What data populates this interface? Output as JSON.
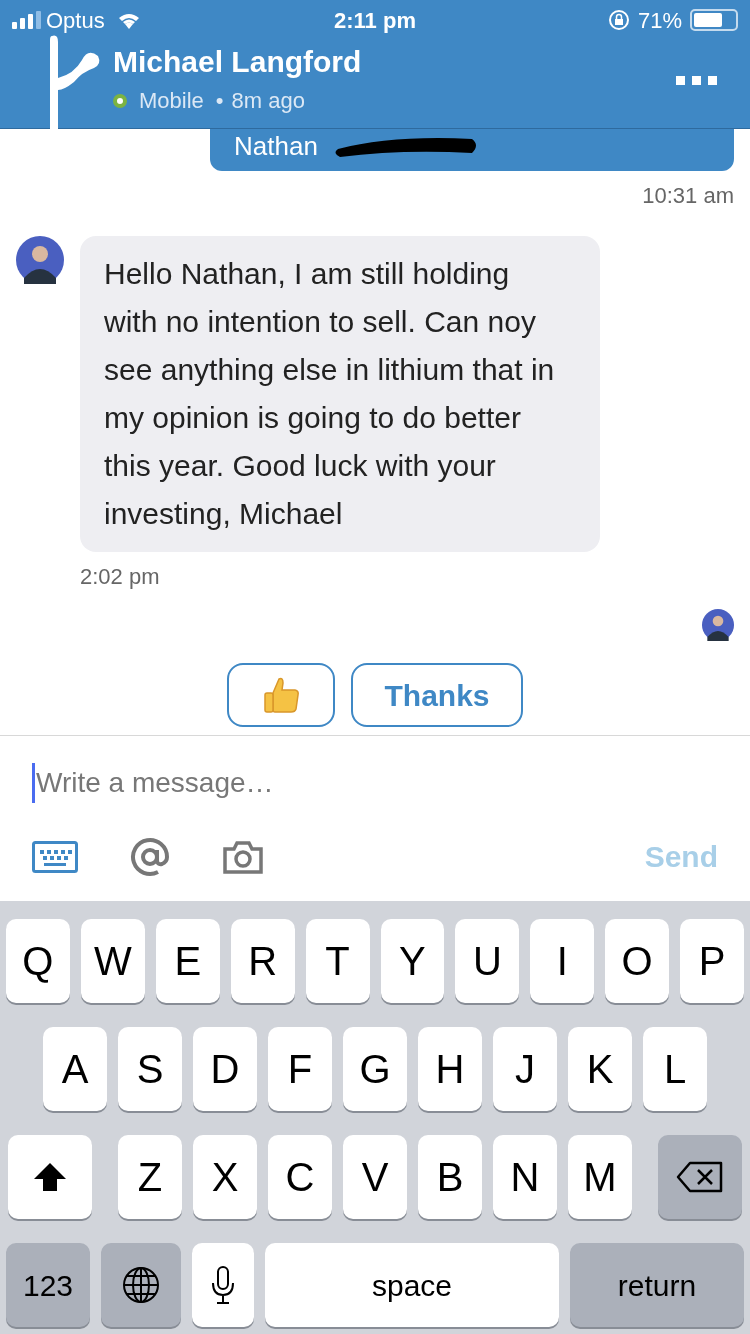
{
  "status_bar": {
    "carrier": "Optus",
    "time": "2:11 pm",
    "battery": "71%"
  },
  "header": {
    "name": "Michael Langford",
    "online": true,
    "presence": "Mobile",
    "separator": "•",
    "last_seen": "8m ago"
  },
  "messages": [
    {
      "kind": "sent",
      "text": "Nathan",
      "time": "10:31 am"
    },
    {
      "kind": "received",
      "text": "Hello Nathan, I am still holding with no intention to sell. Can noy see anything else in lithium that in my opinion is going to do better this year. Good luck with your investing, Michael",
      "time": "2:02 pm"
    }
  ],
  "quick_replies": [
    {
      "kind": "thumbs_up"
    },
    {
      "kind": "text",
      "label": "Thanks"
    }
  ],
  "composer": {
    "placeholder": "Write a message…",
    "send": "Send",
    "send_disabled": true
  },
  "keyboard": {
    "top_letters": [
      {
        "kind": "letter",
        "label": "Q"
      },
      {
        "kind": "letter",
        "label": "W"
      },
      {
        "kind": "letter",
        "label": "E"
      },
      {
        "kind": "letter",
        "label": "R"
      },
      {
        "kind": "letter",
        "label": "T"
      },
      {
        "kind": "letter",
        "label": "Y"
      },
      {
        "kind": "letter",
        "label": "U"
      },
      {
        "kind": "letter",
        "label": "I"
      },
      {
        "kind": "letter",
        "label": "O"
      },
      {
        "kind": "letter",
        "label": "P"
      }
    ],
    "middle_letters": [
      {
        "kind": "letter",
        "label": "A"
      },
      {
        "kind": "letter",
        "label": "S"
      },
      {
        "kind": "letter",
        "label": "D"
      },
      {
        "kind": "letter",
        "label": "F"
      },
      {
        "kind": "letter",
        "label": "G"
      },
      {
        "kind": "letter",
        "label": "H"
      },
      {
        "kind": "letter",
        "label": "J"
      },
      {
        "kind": "letter",
        "label": "K"
      },
      {
        "kind": "letter",
        "label": "L"
      }
    ],
    "bottom_letters": [
      {
        "kind": "shift"
      },
      {
        "kind": "letter",
        "label": "Z"
      },
      {
        "kind": "letter",
        "label": "X"
      },
      {
        "kind": "letter",
        "label": "C"
      },
      {
        "kind": "letter",
        "label": "V"
      },
      {
        "kind": "letter",
        "label": "B"
      },
      {
        "kind": "letter",
        "label": "N"
      },
      {
        "kind": "letter",
        "label": "M"
      },
      {
        "kind": "backspace"
      }
    ],
    "function_keys": [
      {
        "kind": "numbers",
        "label": "123"
      },
      {
        "kind": "globe"
      },
      {
        "kind": "mic"
      },
      {
        "kind": "space",
        "label": "space"
      },
      {
        "kind": "return",
        "label": "return"
      }
    ]
  }
}
